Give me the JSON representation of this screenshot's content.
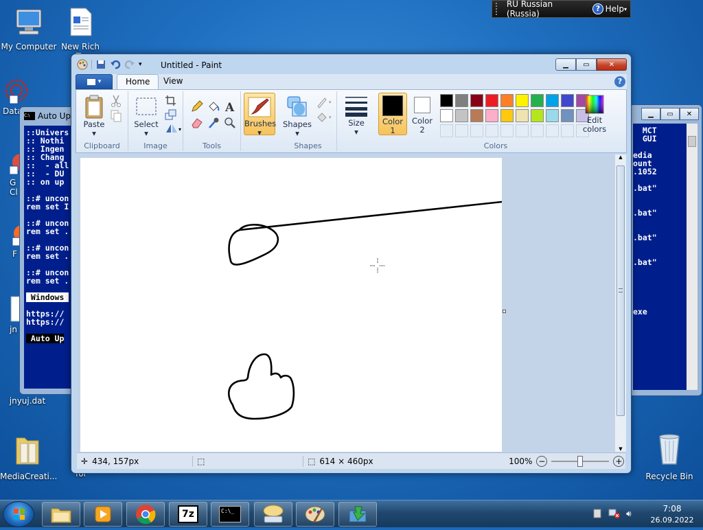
{
  "language_bar": {
    "language": "RU Russian (Russia)",
    "help_label": "Help",
    "help_symbol": "?"
  },
  "desktop_icons": [
    {
      "name": "my-computer",
      "label": "My Computer"
    },
    {
      "name": "new-rich-text",
      "label_line1": "New Rich",
      "label_line2": "Te"
    },
    {
      "name": "data-shortcut",
      "label": "Data"
    },
    {
      "name": "g-shortcut",
      "label_line1": "G",
      "label_line2": "Cl"
    },
    {
      "name": "f-shortcut",
      "label": "F"
    },
    {
      "name": "jn-shortcut",
      "label": "jn"
    },
    {
      "name": "jnyuj-dat",
      "label": "jnyuj.dat"
    },
    {
      "name": "mediacreation",
      "label": "MediaCreati..."
    },
    {
      "name": "folder-partial",
      "label": "for"
    },
    {
      "name": "recycle-bin",
      "label": "Recycle Bin"
    }
  ],
  "console_left": {
    "title": "Auto Up",
    "lines": [
      "::Univers",
      ":: Nothi",
      ":: Ingen",
      ":: Chang",
      "::  - all",
      "::  - DU",
      ":: on up",
      "",
      "::# uncon",
      "rem set I",
      "",
      "::# uncon",
      "rem set .",
      "",
      "::# uncon",
      "rem set .",
      "",
      "::# uncon",
      "rem set ."
    ],
    "highlight_line": " Windows ",
    "url_lines": [
      "https://",
      "https://"
    ],
    "footer_line": " Auto Up"
  },
  "console_right": {
    "lines": [
      "  MCT",
      "  GUI",
      "",
      "edia",
      "ount",
      ".1052",
      "",
      ".bat\"",
      "",
      "",
      ".bat\"",
      "",
      "",
      ".bat\"",
      "",
      "",
      ".bat\"",
      "",
      "",
      "",
      "",
      "",
      "exe"
    ]
  },
  "paint": {
    "title": "Untitled - Paint",
    "tabs": [
      "Home",
      "View"
    ],
    "active_tab": "Home",
    "groups": {
      "clipboard": {
        "label": "Clipboard",
        "paste": "Paste"
      },
      "image": {
        "label": "Image",
        "select": "Select"
      },
      "tools": {
        "label": "Tools"
      },
      "brushes": {
        "label": "Brushes"
      },
      "shapes": {
        "label": "Shapes",
        "shapes_btn": "Shapes"
      },
      "size": {
        "label": "Size"
      },
      "colors": {
        "label": "Colors",
        "color1": {
          "line1": "Color",
          "line2": "1",
          "value": "#000000"
        },
        "color2": {
          "line1": "Color",
          "line2": "2",
          "value": "#ffffff"
        },
        "edit_colors": {
          "line1": "Edit",
          "line2": "colors"
        },
        "palette_row1": [
          "#000000",
          "#7f7f7f",
          "#880015",
          "#ed1c24",
          "#ff7f27",
          "#fff200",
          "#22b14c",
          "#00a2e8",
          "#3f48cc",
          "#a349a4"
        ],
        "palette_row2": [
          "#ffffff",
          "#c3c3c3",
          "#b97a57",
          "#ffaec9",
          "#ffc90e",
          "#efe4b0",
          "#b5e61d",
          "#99d9ea",
          "#7092be",
          "#c8bfe7"
        ]
      }
    },
    "status": {
      "cursor_pos": "434, 157px",
      "canvas_size": "614 × 460px",
      "zoom": "100%"
    }
  },
  "taskbar": {
    "apps": [
      "explorer",
      "media-player",
      "chrome",
      "7zip",
      "command-prompt",
      "on-screen-keyboard",
      "paint",
      "installer"
    ],
    "clock_time": "7:08",
    "clock_date": "26.09.2022",
    "zip_label": "7z",
    "cmd_label": "C:\\_"
  }
}
